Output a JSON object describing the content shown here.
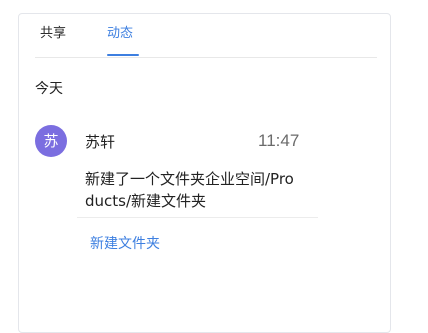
{
  "tabs": [
    {
      "label": "共享",
      "active": false
    },
    {
      "label": "动态",
      "active": true
    }
  ],
  "section": {
    "title": "今天"
  },
  "activity": {
    "avatar_text": "苏",
    "user": "苏轩",
    "time": "11:47",
    "message": "新建了一个文件夹企业空间/Products/新建文件夹",
    "link_label": "新建文件夹"
  },
  "colors": {
    "accent": "#3d7fe0",
    "avatar_bg": "#7b6ee0",
    "border": "#e4e6eb"
  }
}
